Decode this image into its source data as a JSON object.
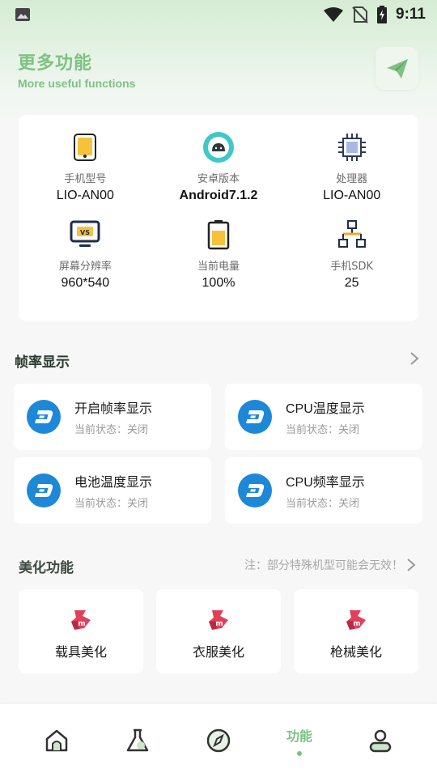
{
  "status_bar": {
    "time": "9:11"
  },
  "header": {
    "title": "更多功能",
    "subtitle": "More useful functions"
  },
  "device_info": [
    {
      "label": "手机型号",
      "value": "LIO-AN00",
      "icon": "phone-icon"
    },
    {
      "label": "安卓版本",
      "value": "Android7.1.2",
      "icon": "android-icon"
    },
    {
      "label": "处理器",
      "value": "LIO-AN00",
      "icon": "cpu-chip-icon"
    },
    {
      "label": "屏幕分辨率",
      "value": "960*540",
      "icon": "monitor-icon"
    },
    {
      "label": "当前电量",
      "value": "100%",
      "icon": "battery-icon"
    },
    {
      "label": "手机SDK",
      "value": "25",
      "icon": "network-icon"
    }
  ],
  "fps_section": {
    "title": "帧率显示",
    "items": [
      {
        "title": "开启帧率显示",
        "state": "当前状态：关闭"
      },
      {
        "title": "CPU温度显示",
        "state": "当前状态：关闭"
      },
      {
        "title": "电池温度显示",
        "state": "当前状态：关闭"
      },
      {
        "title": "CPU频率显示",
        "state": "当前状态：关闭"
      }
    ]
  },
  "beauty_section": {
    "title": "美化功能",
    "note": "注：部分特殊机型可能会无效！",
    "items": [
      {
        "label": "载具美化"
      },
      {
        "label": "衣服美化"
      },
      {
        "label": "枪械美化"
      }
    ]
  },
  "bottom_nav": {
    "active_label": "功能",
    "items": [
      "home-icon",
      "flask-icon",
      "compass-icon",
      "功能",
      "user-icon"
    ]
  },
  "colors": {
    "accent": "#7fc184",
    "fps_icon": "#1e88d8",
    "beauty_icon": "#e0405a"
  }
}
